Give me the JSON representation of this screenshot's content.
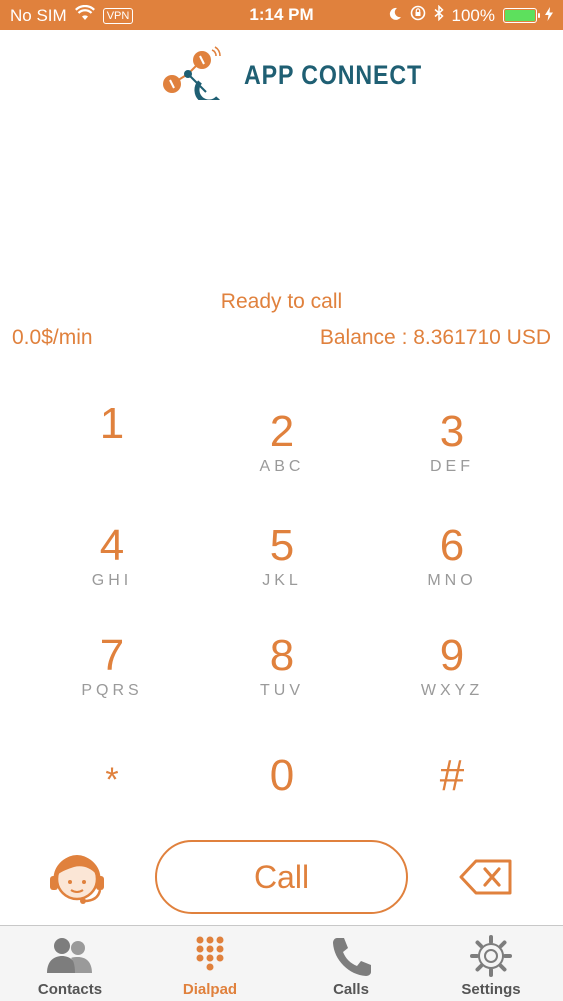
{
  "status_bar": {
    "carrier": "No SIM",
    "vpn": "VPN",
    "time": "1:14 PM",
    "battery": "100%"
  },
  "header": {
    "logo_text": "APP CONNECT"
  },
  "status": {
    "ready": "Ready to call",
    "rate": "0.0$/min",
    "balance": "Balance : 8.361710 USD"
  },
  "dialpad": [
    {
      "digit": "1",
      "letters": ""
    },
    {
      "digit": "2",
      "letters": "ABC"
    },
    {
      "digit": "3",
      "letters": "DEF"
    },
    {
      "digit": "4",
      "letters": "GHI"
    },
    {
      "digit": "5",
      "letters": "JKL"
    },
    {
      "digit": "6",
      "letters": "MNO"
    },
    {
      "digit": "7",
      "letters": "PQRS"
    },
    {
      "digit": "8",
      "letters": "TUV"
    },
    {
      "digit": "9",
      "letters": "WXYZ"
    },
    {
      "digit": "*",
      "letters": ""
    },
    {
      "digit": "0",
      "letters": ""
    },
    {
      "digit": "#",
      "letters": ""
    }
  ],
  "actions": {
    "call_label": "Call"
  },
  "tabs": [
    {
      "label": "Contacts",
      "icon": "contacts-icon"
    },
    {
      "label": "Dialpad",
      "icon": "dialpad-icon"
    },
    {
      "label": "Calls",
      "icon": "phone-icon"
    },
    {
      "label": "Settings",
      "icon": "gear-icon"
    }
  ],
  "colors": {
    "accent": "#e0813d",
    "brand_teal": "#1f5f73",
    "tab_inactive": "#555555"
  }
}
